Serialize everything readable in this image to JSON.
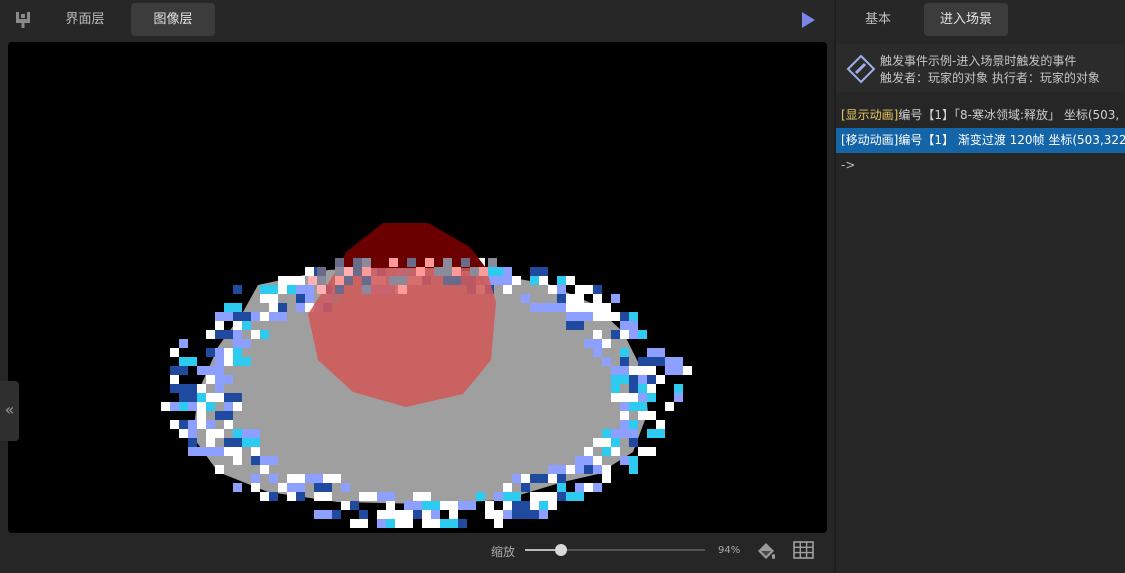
{
  "left_tabs": {
    "ui_layer": "界面层",
    "image_layer": "图像层"
  },
  "zoom": {
    "label": "缩放",
    "value_text": "94%",
    "fraction": 0.2
  },
  "right_tabs": {
    "basic": "基本",
    "enter_scene": "进入场景"
  },
  "event": {
    "title": "触发事件示例-进入场景时触发的事件",
    "subtitle": "触发者：玩家的对象  执行者：玩家的对象"
  },
  "commands": [
    {
      "tag": "[显示动画]",
      "text": "编号【1】「8-寒冰领域:释放」  坐标(503,",
      "tag_color": "#e7c65e",
      "selected": false
    },
    {
      "tag": "[移动动画]",
      "text": "编号【1】 渐变过渡 120帧  坐标(503,322",
      "tag_color": "#ffffff",
      "selected": true
    }
  ],
  "end_marker": "->",
  "icons": {
    "logo": "app-logo-icon",
    "play": "play-icon",
    "collapse": "double-chevron-left-icon",
    "bucket": "paint-bucket-icon",
    "grid": "grid-icon",
    "event": "pencil-diamond-icon"
  },
  "colors": {
    "accent_selected": "#1464a8",
    "play": "#7b86e8",
    "ice_light": "#8da0ff",
    "ice_dark": "#1f4aa0",
    "ice_cyan": "#2ecbf0",
    "ground_gray": "#9f9f9f",
    "red_zone": "#d25a5a"
  }
}
